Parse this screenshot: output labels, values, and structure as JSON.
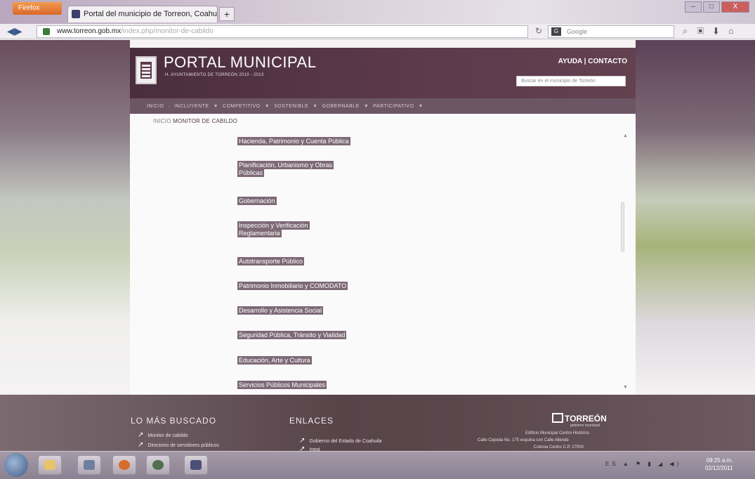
{
  "browser": {
    "firefox_button": "Firefox",
    "tab_title": "Portal del municipio de Torreon, Coahui...",
    "new_tab": "+",
    "url_domain": "www.torreon.gob.mx",
    "url_path": "/index.php/monitor-de-cabildo",
    "search_placeholder": "Google",
    "window_controls": [
      "–",
      "□",
      "X"
    ]
  },
  "site": {
    "title": "PORTAL MUNICIPAL",
    "subtitle": "H. AYUNTAMIENTO DE TORREÓN 2010 - 2013",
    "header_links": "AYUDA | CONTACTO",
    "search_placeholder": "Buscar en el municipio de Torreón",
    "menu": [
      "INICIO",
      "INCLUYENTE",
      "COMPETITIVO",
      "SOSTENIBLE",
      "GOBERNABLE",
      "PARTICIPATIVO"
    ],
    "breadcrumb_home": "INICIO",
    "breadcrumb_current": "MONITOR DE CABILDO"
  },
  "commissions": [
    "Hacienda, Patrimonio y Cuenta Pública",
    "Planificación, Urbanismo y Obras Públicas",
    "Gobernación",
    "Inspección y Verificación Reglamentaria",
    "Autotransporte Público",
    "Patrimonio Inmobiliario y COMODATO",
    "Desarrollo y Asistencia Social",
    "Seguridad Pública, Tránsito y Vialidad",
    "Educación, Arte y Cultura",
    "Servicios Públicos Municipales"
  ],
  "footer": {
    "col1_title": "LO MÁS BUSCADO",
    "col1_links": [
      "Monitor de cabildo",
      "Directorio de servidores públicos"
    ],
    "col2_title": "ENLACES",
    "col2_links": [
      "Gobierno del Estado de Coahuila",
      "Inegi"
    ],
    "logo": "TORREÓN",
    "logo_tag": "gobierno municipal",
    "address_1": "Edificio Municipal Centro Histórico",
    "address_2": "Calle Cepeda No. 175 esquina con Calle Allende",
    "address_3": "Colonia Centro C.P. 27000"
  },
  "taskbar": {
    "time": "09:25 a.m.",
    "date": "02/12/2011",
    "tray": "ES"
  }
}
